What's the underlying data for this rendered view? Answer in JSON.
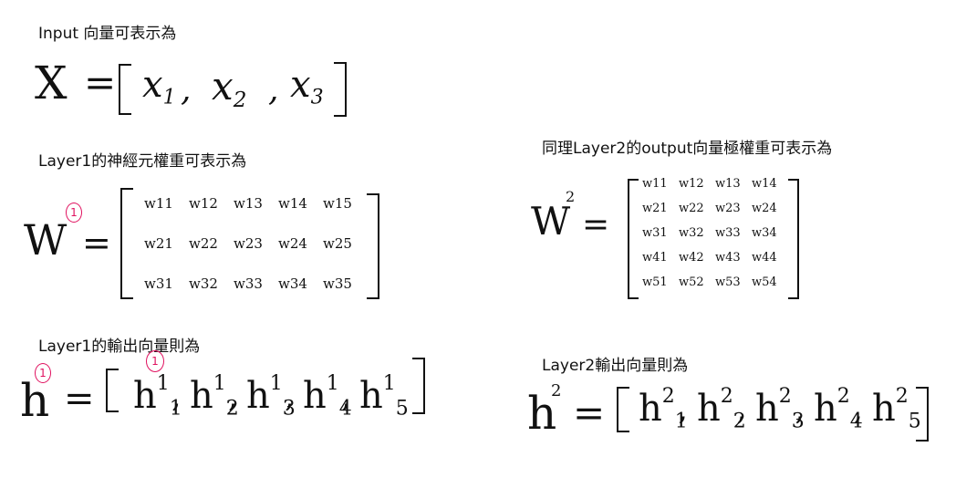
{
  "captions": {
    "input": "Input 向量可表示為",
    "layer1_weights": "Layer1的神經元權重可表示為",
    "layer2_weights": "同理Layer2的output向量極權重可表示為",
    "layer1_output": "Layer1的輸出向量則為",
    "layer2_output": "Layer2輸出向量則為"
  },
  "eq_input": {
    "lhs": "X",
    "eq": "=",
    "terms": [
      {
        "base": "x",
        "sub": "1"
      },
      {
        "base": "x",
        "sub": "2"
      },
      {
        "base": "x",
        "sub": "3"
      }
    ]
  },
  "eq_w1": {
    "lhs": "W",
    "sup": "1",
    "eq": "=",
    "rows": [
      [
        "w11",
        "w12",
        "w13",
        "w14",
        "w15"
      ],
      [
        "w21",
        "w22",
        "w23",
        "w24",
        "w25"
      ],
      [
        "w31",
        "w32",
        "w33",
        "w34",
        "w35"
      ]
    ]
  },
  "eq_w2": {
    "lhs": "W",
    "sup": "2",
    "eq": "=",
    "rows": [
      [
        "w11",
        "w12",
        "w13",
        "w14"
      ],
      [
        "w21",
        "w22",
        "w23",
        "w24"
      ],
      [
        "w31",
        "w32",
        "w33",
        "w34"
      ],
      [
        "w41",
        "w42",
        "w43",
        "w44"
      ],
      [
        "w51",
        "w52",
        "w53",
        "w54"
      ]
    ]
  },
  "eq_h1": {
    "lhs": "h",
    "sup": "1",
    "eq": "=",
    "terms": [
      {
        "base": "h",
        "sub": "1",
        "sup": "1"
      },
      {
        "base": "h",
        "sub": "2",
        "sup": "1"
      },
      {
        "base": "h",
        "sub": "3",
        "sup": "1"
      },
      {
        "base": "h",
        "sub": "4",
        "sup": "1"
      },
      {
        "base": "h",
        "sub": "5",
        "sup": "1"
      }
    ]
  },
  "eq_h2": {
    "lhs": "h",
    "sup": "2",
    "eq": "=",
    "terms": [
      {
        "base": "h",
        "sub": "1",
        "sup": "2"
      },
      {
        "base": "h",
        "sub": "2",
        "sup": "2"
      },
      {
        "base": "h",
        "sub": "3",
        "sup": "2"
      },
      {
        "base": "h",
        "sub": "4",
        "sup": "2"
      },
      {
        "base": "h",
        "sub": "5",
        "sup": "2"
      }
    ]
  },
  "colors": {
    "ink": "#111111",
    "highlight": "#e0115f"
  }
}
